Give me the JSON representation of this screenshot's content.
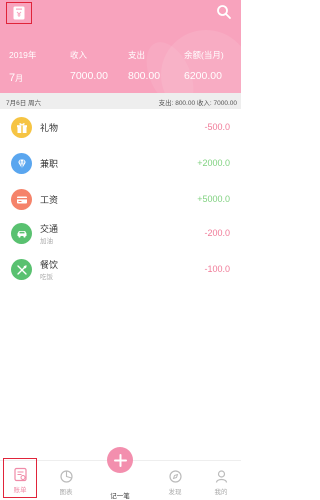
{
  "header": {
    "year": "2019年",
    "month_num": "7",
    "month_unit": "月",
    "income_label": "收入",
    "income_value": "7000.00",
    "expense_label": "支出",
    "expense_value": "800.00",
    "balance_label": "余额(当月)",
    "balance_value": "6200.00"
  },
  "daybar": {
    "date": "7月6日 周六",
    "totals": "支出: 800.00   收入: 7000.00"
  },
  "records": [
    {
      "name": "礼物",
      "note": "",
      "amount": "-500.0",
      "kind": "exp",
      "icon": "gift-icon",
      "color": "#f6c443"
    },
    {
      "name": "兼职",
      "note": "",
      "amount": "+2000.0",
      "kind": "inc",
      "icon": "diamond-icon",
      "color": "#5aa6ef"
    },
    {
      "name": "工资",
      "note": "",
      "amount": "+5000.0",
      "kind": "inc",
      "icon": "card-icon",
      "color": "#f5836a"
    },
    {
      "name": "交通",
      "note": "加油",
      "amount": "-200.0",
      "kind": "exp",
      "icon": "car-icon",
      "color": "#59c170"
    },
    {
      "name": "餐饮",
      "note": "吃饭",
      "amount": "-100.0",
      "kind": "exp",
      "icon": "dining-icon",
      "color": "#59c170"
    }
  ],
  "tabs": {
    "bill": "账单",
    "chart": "图表",
    "record": "记一笔",
    "find": "发现",
    "mine": "我的"
  },
  "colors": {
    "header": "#f8a3bd",
    "accent": "#f38fae",
    "expense": "#f07b98",
    "income": "#7fd17f"
  }
}
